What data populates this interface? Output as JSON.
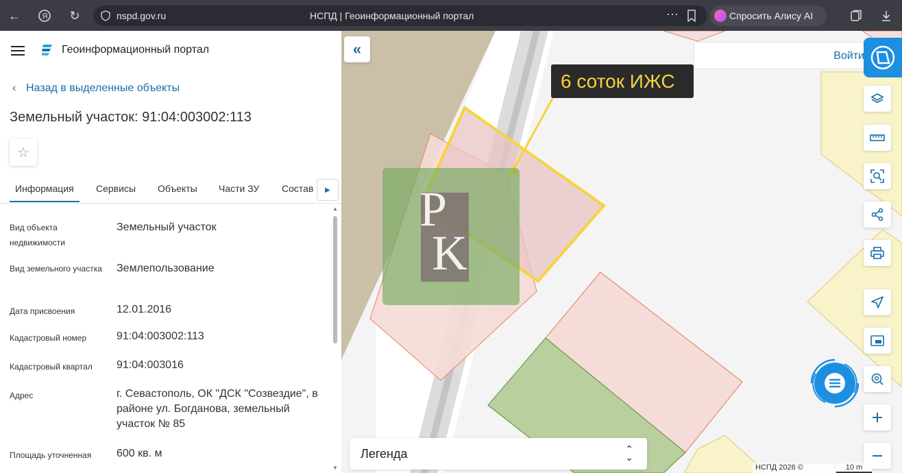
{
  "browser": {
    "url": "nspd.gov.ru",
    "page_title": "НСПД | Геоинформационный портал",
    "alice_button": "Спросить Алису AI"
  },
  "panel": {
    "app_title": "Геоинформационный портал",
    "back_link": "Назад в выделенные объекты",
    "object_title": "Земельный участок: 91:04:003002:113",
    "tabs": [
      {
        "label": "Информация",
        "active": true
      },
      {
        "label": "Сервисы",
        "active": false
      },
      {
        "label": "Объекты",
        "active": false
      },
      {
        "label": "Части ЗУ",
        "active": false
      },
      {
        "label": "Состав",
        "active": false
      }
    ],
    "info_rows": [
      {
        "label": "Вид объекта недвижимости",
        "value": "Земельный участок"
      },
      {
        "label": "Вид земельного участка",
        "value": "Землепользование"
      },
      {
        "label": "Дата присвоения",
        "value": "12.01.2016"
      },
      {
        "label": "Кадастровый номер",
        "value": "91:04:003002:113"
      },
      {
        "label": "Кадастровый квартал",
        "value": "91:04:003016"
      },
      {
        "label": "Адрес",
        "value": "г. Севастополь, ОК \"ДСК \"Созвездие\", в районе ул. Богданова, земельный участок № 85"
      },
      {
        "label": "Площадь уточненная",
        "value": "600 кв. м"
      }
    ]
  },
  "map": {
    "login": "Войти",
    "annotation": "6 соток ИЖС",
    "watermark_text": "РК",
    "legend": "Легенда",
    "attribution": "НСПД 2026 ©",
    "scale": "10 m",
    "highlight_color": "#f7d33d",
    "accent_color": "#1a6ea8",
    "tools": [
      "layers-icon",
      "ruler-icon",
      "select-area-icon",
      "share-icon",
      "print-icon",
      "locate-icon",
      "minimap-icon",
      "search-location-icon",
      "zoom-in-icon",
      "zoom-out-icon"
    ]
  }
}
